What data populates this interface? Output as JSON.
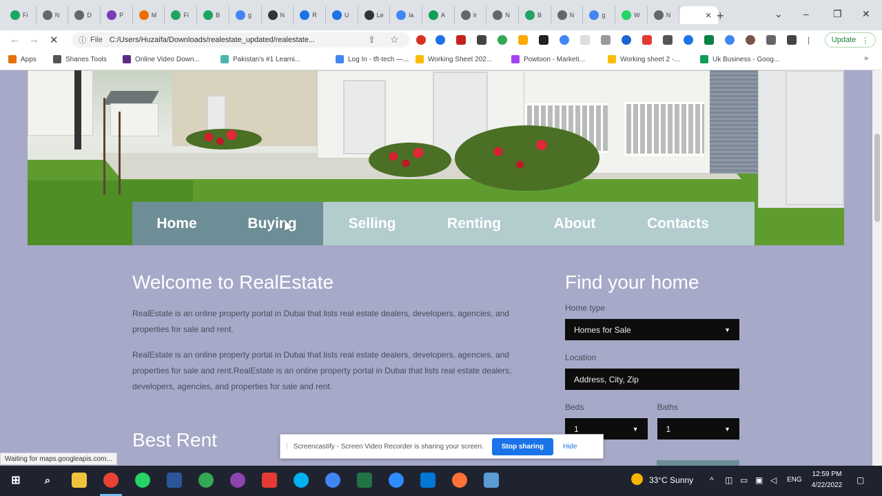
{
  "browser": {
    "tabs": [
      {
        "label": "Fi",
        "icon": "green-circle-icon",
        "color": "#1fa463"
      },
      {
        "label": "N",
        "icon": "gray-circle-icon",
        "color": "#666"
      },
      {
        "label": "D",
        "icon": "gray-circle-icon",
        "color": "#666"
      },
      {
        "label": "P",
        "icon": "purple-square-icon",
        "color": "#7b3ab8"
      },
      {
        "label": "M",
        "icon": "orange-square-icon",
        "color": "#ef6c00"
      },
      {
        "label": "Fi",
        "icon": "green-circle-icon",
        "color": "#1fa463"
      },
      {
        "label": "B",
        "icon": "green-circle-icon",
        "color": "#1fa463"
      },
      {
        "label": "g",
        "icon": "google-icon",
        "color": "#4285f4"
      },
      {
        "label": "N",
        "icon": "hat-icon",
        "color": "#333"
      },
      {
        "label": "R",
        "icon": "blue-circle-icon",
        "color": "#1a73e8"
      },
      {
        "label": "U",
        "icon": "blue-circle-icon",
        "color": "#1a73e8"
      },
      {
        "label": "Le",
        "icon": "l-icon",
        "color": "#333"
      },
      {
        "label": "la",
        "icon": "google-icon",
        "color": "#4285f4"
      },
      {
        "label": "A",
        "icon": "green-circle-icon",
        "color": "#0f9d58"
      },
      {
        "label": "Ir",
        "icon": "gray-circle-icon",
        "color": "#666"
      },
      {
        "label": "N",
        "icon": "gray-circle-icon",
        "color": "#666"
      },
      {
        "label": "B",
        "icon": "green-circle-icon",
        "color": "#1fa463"
      },
      {
        "label": "N",
        "icon": "gray-circle-icon",
        "color": "#666"
      },
      {
        "label": "g",
        "icon": "google-icon",
        "color": "#4285f4"
      },
      {
        "label": "W",
        "icon": "whatsapp-icon",
        "color": "#25d366"
      },
      {
        "label": "N",
        "icon": "gray-circle-icon",
        "color": "#666"
      }
    ],
    "active_tab_close": "×",
    "new_tab": "+",
    "window_controls": {
      "menu": "⌄",
      "minimize": "–",
      "maximize": "❐",
      "close": "✕"
    },
    "address": {
      "info_icon": "ⓘ",
      "scheme_label": "File",
      "url": "C:/Users/Huzaifa/Downloads/realestate_updated/realestate..."
    },
    "update_button": "Update",
    "bookmarks": [
      {
        "label": "Apps",
        "icon": "apps-grid-icon",
        "color": "#e8710a"
      },
      {
        "label": "Shanes Tools",
        "icon": "globe-icon",
        "color": "#555"
      },
      {
        "label": "Online Video Down...",
        "icon": "video-icon",
        "color": "#5a2d82"
      },
      {
        "label": "Pakistan's #1 Learni...",
        "icon": "globe-icon",
        "color": "#4db6ac"
      },
      {
        "label": "Log In - tft-tech —...",
        "icon": "globe-icon",
        "color": "#4285f4"
      },
      {
        "label": "Working Sheet 202...",
        "icon": "drive-icon",
        "color": "#fbbc04"
      },
      {
        "label": "Powtoon - Marketi...",
        "icon": "powtoon-icon",
        "color": "#a142f4"
      },
      {
        "label": "Working sheet 2 -...",
        "icon": "drive-icon",
        "color": "#fbbc04"
      },
      {
        "label": "Uk Business - Goog...",
        "icon": "sheets-icon",
        "color": "#0f9d58"
      }
    ],
    "bookmarks_more": "»",
    "status_text": "Waiting for maps.googleapis.com..."
  },
  "site": {
    "nav": [
      {
        "label": "Home"
      },
      {
        "label": "Buying"
      },
      {
        "label": "Selling"
      },
      {
        "label": "Renting"
      },
      {
        "label": "About"
      },
      {
        "label": "Contacts"
      }
    ],
    "active_nav": "Home",
    "welcome": {
      "title": "Welcome to RealEstate",
      "p1": "RealEstate is an online property portal in Dubai that lists real estate dealers, developers, agencies, and properties for sale and rent.",
      "p2": "RealEstate is an online property portal in Dubai that lists real estate dealers, developers, agencies, and properties for sale and rent.RealEstate is an online property portal in Dubai that lists real estate dealers, developers, agencies, and properties for sale and rent."
    },
    "best_rent_title": "Best Rent",
    "find": {
      "title": "Find your home",
      "home_type_label": "Home type",
      "home_type_value": "Homes for Sale",
      "location_label": "Location",
      "location_placeholder": "Address, City, Zip",
      "beds_label": "Beds",
      "beds_value": "1",
      "baths_label": "Baths",
      "baths_value": "1"
    },
    "colors": {
      "page_bg": "#a6a9c8",
      "nav_bg": "#b3cccd",
      "nav_active": "#6d8e96"
    }
  },
  "share_bar": {
    "message": "Screencastify - Screen Video Recorder is sharing your screen.",
    "stop_button": "Stop sharing",
    "hide_link": "Hide"
  },
  "taskbar": {
    "weather": "33°C  Sunny",
    "language": "ENG",
    "time": "12:59 PM",
    "date": "4/22/2022"
  }
}
